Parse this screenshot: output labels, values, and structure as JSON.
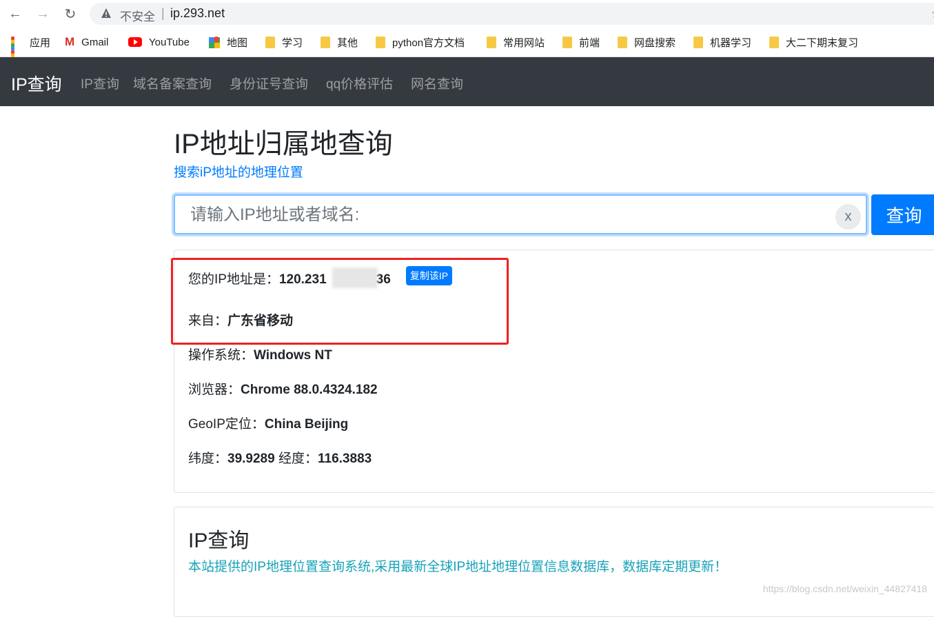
{
  "browser": {
    "security_label": "不安全",
    "separator": "|",
    "url": "ip.293.net",
    "star": "☆"
  },
  "bookmarks": [
    {
      "label": "应用",
      "icon": "apps-grid-icon"
    },
    {
      "label": "Gmail",
      "icon": "gmail-icon"
    },
    {
      "label": "YouTube",
      "icon": "youtube-icon"
    },
    {
      "label": "地图",
      "icon": "maps-icon"
    },
    {
      "label": "学习",
      "icon": "folder-icon"
    },
    {
      "label": "其他",
      "icon": "folder-icon"
    },
    {
      "label": "python官方文档",
      "icon": "folder-icon"
    },
    {
      "label": "常用网站",
      "icon": "folder-icon"
    },
    {
      "label": "前端",
      "icon": "folder-icon"
    },
    {
      "label": "网盘搜索",
      "icon": "folder-icon"
    },
    {
      "label": "机器学习",
      "icon": "folder-icon"
    },
    {
      "label": "大二下期末复习",
      "icon": "folder-icon"
    }
  ],
  "navbar": {
    "brand": "IP查询",
    "links": [
      "IP查询",
      "域名备案查询",
      "身份证号查询",
      "qq价格评估",
      "网名查询"
    ]
  },
  "header": {
    "title": "IP地址归属地查询",
    "subtitle": "搜索iP地址的地理位置"
  },
  "search": {
    "placeholder": "请输入IP地址或者域名:",
    "clear_label": "x",
    "submit_label": "查询"
  },
  "info": {
    "ip_label": "您的IP地址是：",
    "ip_value_start": "120.231",
    "ip_value_end": "36",
    "copy_label": "复制该IP",
    "from_label": "来自：",
    "from_value": "广东省移动",
    "os_label": "操作系统：",
    "os_value": "Windows NT",
    "browser_label": "浏览器：",
    "browser_value": "Chrome 88.0.4324.182",
    "geo_label": "GeoIP定位：",
    "geo_value": "China Beijing",
    "lat_label": "纬度：",
    "lat_value": "39.9289",
    "lng_label": "经度：",
    "lng_value": "116.3883"
  },
  "about": {
    "title": "IP查询",
    "text": "本站提供的IP地理位置查询系统,采用最新全球IP地址地理位置信息数据库，数据库定期更新！"
  },
  "watermark": "https://blog.csdn.net/weixin_44827418",
  "colors": {
    "navbar_bg": "#343a40",
    "primary": "#007bff",
    "info_text": "#17a2b8",
    "highlight_border": "#f02020"
  }
}
